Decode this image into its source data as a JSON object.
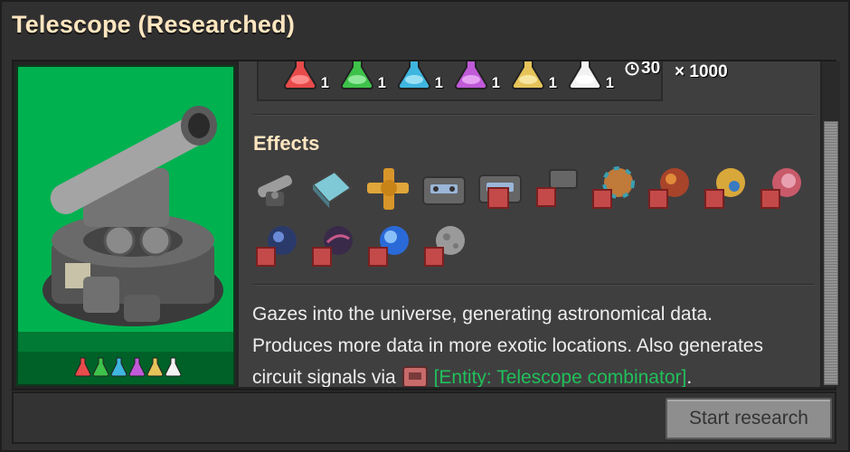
{
  "window": {
    "title": "Telescope (Researched)"
  },
  "cost": {
    "packs": [
      {
        "name": "automation-science-pack",
        "color": "#e84b4b",
        "count": "1"
      },
      {
        "name": "logistic-science-pack",
        "color": "#3ec24a",
        "count": "1"
      },
      {
        "name": "military-science-pack",
        "color": "#3fb6e0",
        "count": "1"
      },
      {
        "name": "chemical-science-pack",
        "color": "#c05ad8",
        "count": "1"
      },
      {
        "name": "production-science-pack",
        "color": "#e6c45a",
        "count": "1"
      },
      {
        "name": "space-science-pack",
        "color": "#f2f2f2",
        "count": "1"
      }
    ],
    "time": "30",
    "multiplier": "× 1000"
  },
  "effects": {
    "heading": "Effects",
    "icons": [
      "telescope-icon",
      "tech-card-icon",
      "pipe-cross-icon",
      "tape-icon",
      "tape-data-icon",
      "tape-bits-icon",
      "planet-a-data-icon",
      "planet-b-data-icon",
      "planet-c-data-icon",
      "planet-d-data-icon",
      "planet-e-data-icon",
      "planet-f-data-icon",
      "planet-g-data-icon",
      "moon-icon"
    ]
  },
  "description": {
    "line1": "Gazes into the universe, generating astronomical data.",
    "line2": "Produces more data in more exotic locations. Also generates",
    "line3_prefix": "circuit signals via ",
    "entity_link": "[Entity: Telescope combinator]",
    "line3_suffix": "."
  },
  "footer": {
    "start_button": "Start research"
  },
  "colors": {
    "title": "#ffe6c0",
    "card_bg": "#00b150",
    "link": "#20c05a"
  }
}
